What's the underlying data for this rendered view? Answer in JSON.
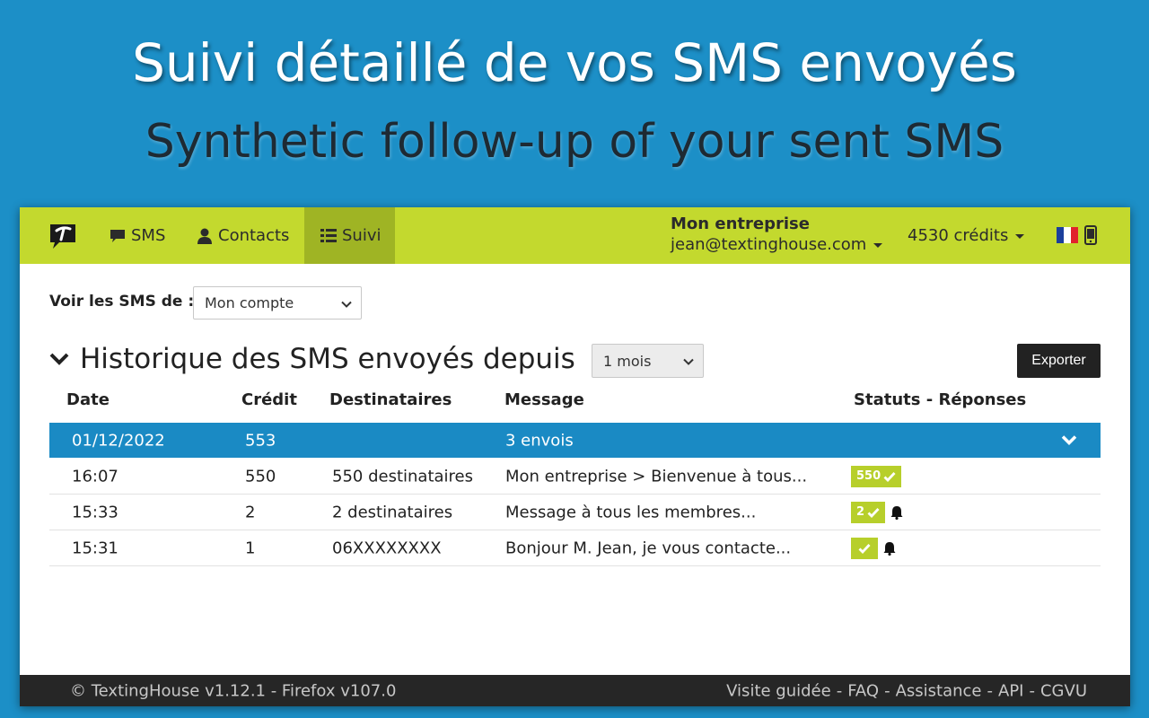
{
  "promo": {
    "title_fr": "Suivi détaillé de vos SMS envoyés",
    "title_en": "Synthetic follow-up of your sent SMS"
  },
  "navbar": {
    "logo_icon": "textinghouse-logo-icon",
    "items": [
      {
        "label": "SMS",
        "icon": "chat-bubble-icon"
      },
      {
        "label": "Contacts",
        "icon": "user-icon"
      },
      {
        "label": "Suivi",
        "icon": "list-icon",
        "active": true
      }
    ],
    "account_name": "Mon entreprise",
    "account_email": "jean@textinghouse.com",
    "credits": "4530 crédits",
    "flag_icon": "french-flag-icon",
    "device_icon": "mobile-phone-icon"
  },
  "filter": {
    "label": "Voir les SMS de :",
    "selected": "Mon compte"
  },
  "history": {
    "title": "Historique des SMS envoyés depuis",
    "period_selected": "1 mois",
    "export_label": "Exporter"
  },
  "table": {
    "headers": {
      "date": "Date",
      "credit": "Crédit",
      "recipients": "Destinataires",
      "message": "Message",
      "status": "Statuts - Réponses"
    },
    "group": {
      "date": "01/12/2022",
      "credit": "553",
      "message": "3 envois"
    },
    "rows": [
      {
        "time": "16:07",
        "credit": "550",
        "recipients": "550 destinataires",
        "message": "Mon entreprise > Bienvenue à tous...",
        "badge": "550",
        "bell": false
      },
      {
        "time": "15:33",
        "credit": "2",
        "recipients": "2 destinataires",
        "message": "Message à tous les membres...",
        "badge": "2",
        "bell": true
      },
      {
        "time": "15:31",
        "credit": "1",
        "recipients": "06XXXXXXXX",
        "message": "Bonjour M. Jean, je vous contacte...",
        "badge": "",
        "bell": true
      }
    ]
  },
  "footer": {
    "left": "© TextingHouse v1.12.1 - Firefox v107.0",
    "links": [
      "Visite guidée",
      "FAQ",
      "Assistance",
      "API",
      "CGVU"
    ],
    "separator": "-"
  },
  "colors": {
    "navbar": "#c3d92e",
    "navbar_active": "#9fb424",
    "group_row": "#1a8ac4",
    "badge": "#b7cf2b",
    "background": "#1c8fc7"
  }
}
